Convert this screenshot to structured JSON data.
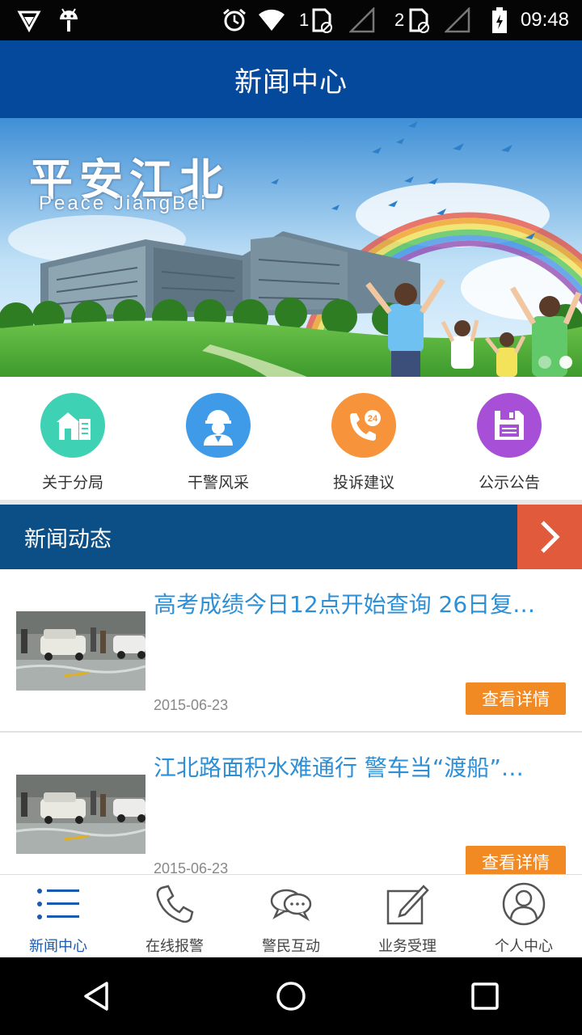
{
  "status_bar": {
    "time": "09:48",
    "sim1": "1",
    "sim2": "2",
    "icons": [
      "vpn-icon",
      "android-icon",
      "alarm-icon",
      "wifi-icon",
      "sim-icon",
      "signal-icon",
      "battery-icon"
    ]
  },
  "app_bar": {
    "title": "新闻中心"
  },
  "banner": {
    "title": "平安江北",
    "subtitle": "Peace JiangBei",
    "slide_count": 2,
    "active_slide": 2
  },
  "quick_menu": [
    {
      "label": "关于分局",
      "icon": "building-icon",
      "color": "#3fd1b4"
    },
    {
      "label": "干警风采",
      "icon": "police-officer-icon",
      "color": "#3f9be8"
    },
    {
      "label": "投诉建议",
      "icon": "phone-24-icon",
      "color": "#f7933a"
    },
    {
      "label": "公示公告",
      "icon": "floppy-disk-icon",
      "color": "#a84fd8"
    }
  ],
  "news_section": {
    "title": "新闻动态",
    "more_icon": "chevron-right-icon"
  },
  "news": [
    {
      "title": "高考成绩今日12点开始查询 26日复…",
      "date": "2015-06-23",
      "button": "查看详情"
    },
    {
      "title": "江北路面积水难通行 警车当“渡船”…",
      "date": "2015-06-23",
      "button": "查看详情"
    }
  ],
  "tabs": [
    {
      "label": "新闻中心",
      "icon": "news-list-icon",
      "active": true
    },
    {
      "label": "在线报警",
      "icon": "phone-icon",
      "active": false
    },
    {
      "label": "警民互动",
      "icon": "chat-bubbles-icon",
      "active": false
    },
    {
      "label": "业务受理",
      "icon": "edit-icon",
      "active": false
    },
    {
      "label": "个人中心",
      "icon": "person-icon",
      "active": false
    }
  ],
  "colors": {
    "app_bar": "#05499c",
    "section_header": "#0b4f86",
    "section_more": "#e25a3c",
    "news_title": "#2d8fd6",
    "detail_button": "#f28a23",
    "active_tab": "#1a5ab0"
  }
}
